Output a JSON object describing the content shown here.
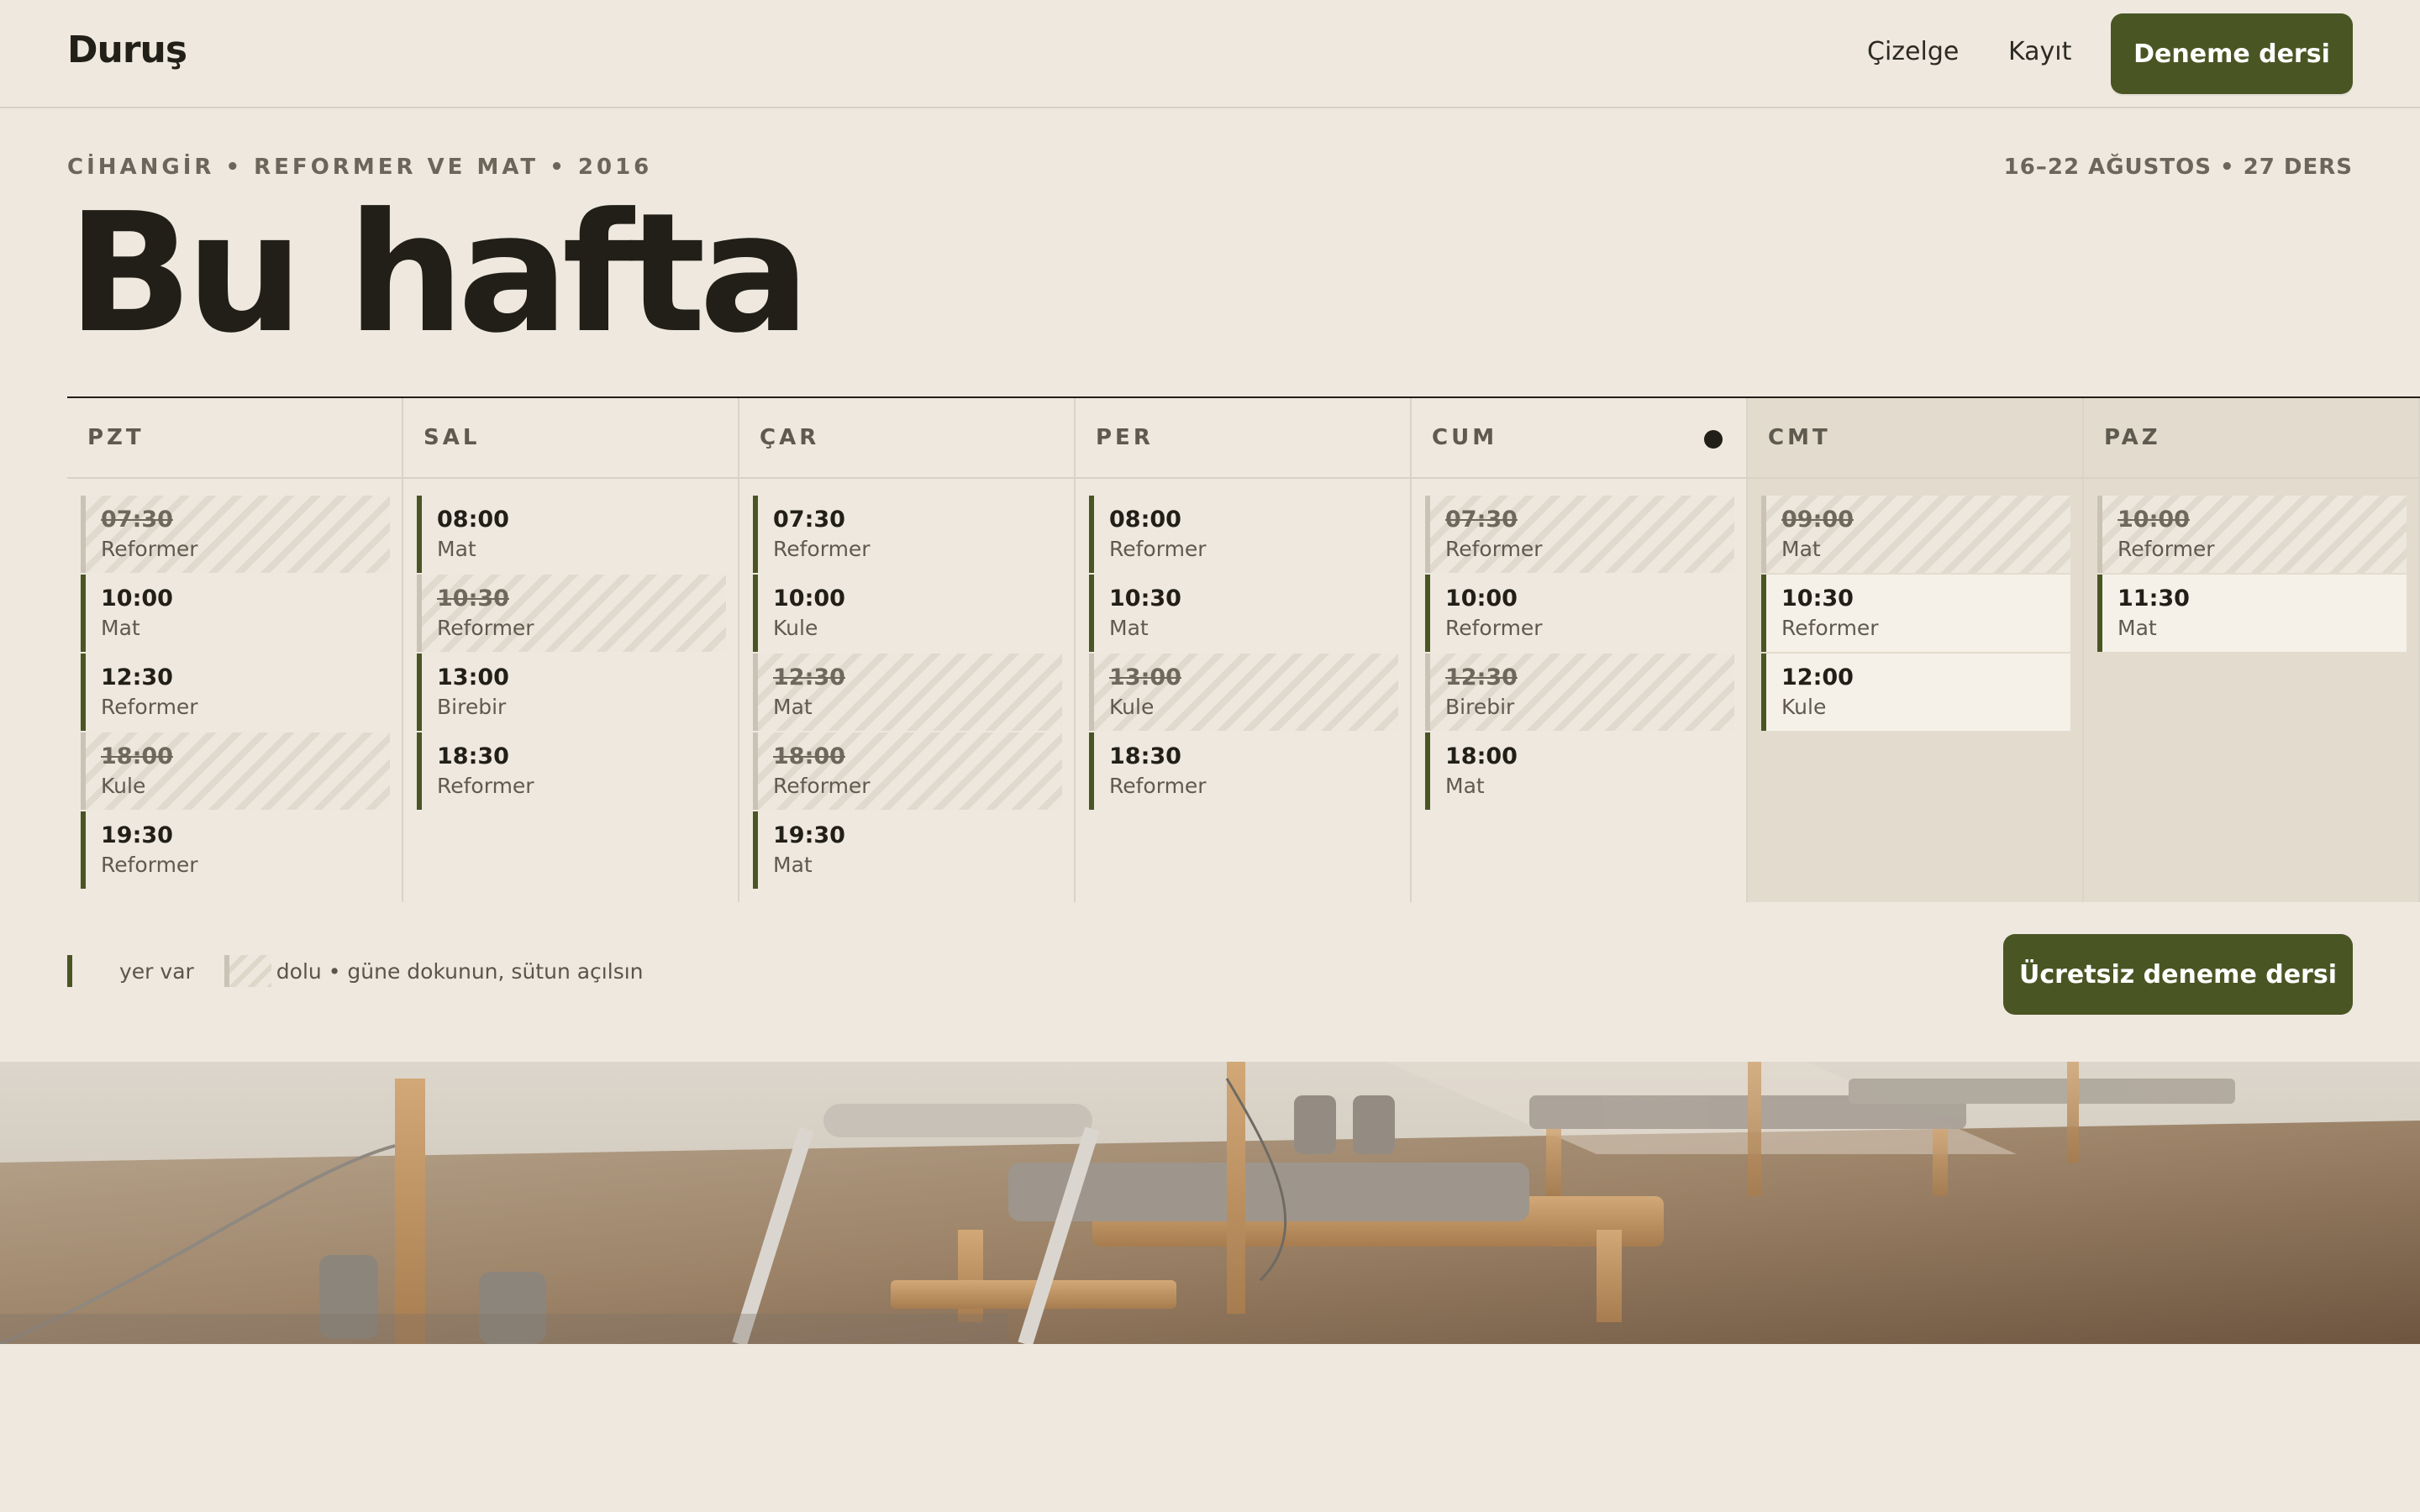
{
  "nav": {
    "logo": "Duruş",
    "links": [
      "Çizelge",
      "Kayıt"
    ],
    "cta": "Deneme dersi"
  },
  "header": {
    "eyebrow": "CİHANGİR • REFORMER VE MAT • 2016",
    "week_meta": "16–22 AĞUSTOS • 27 DERS",
    "title": "Bu hafta"
  },
  "schedule": {
    "days": [
      {
        "label": "PZT",
        "today": false,
        "weekend": false,
        "slots": [
          {
            "time": "07:30",
            "type": "Reformer",
            "full": true
          },
          {
            "time": "10:00",
            "type": "Mat",
            "full": false
          },
          {
            "time": "12:30",
            "type": "Reformer",
            "full": false
          },
          {
            "time": "18:00",
            "type": "Kule",
            "full": true
          },
          {
            "time": "19:30",
            "type": "Reformer",
            "full": false
          }
        ]
      },
      {
        "label": "SAL",
        "today": false,
        "weekend": false,
        "slots": [
          {
            "time": "08:00",
            "type": "Mat",
            "full": false
          },
          {
            "time": "10:30",
            "type": "Reformer",
            "full": true
          },
          {
            "time": "13:00",
            "type": "Birebir",
            "full": false
          },
          {
            "time": "18:30",
            "type": "Reformer",
            "full": false
          }
        ]
      },
      {
        "label": "ÇAR",
        "today": false,
        "weekend": false,
        "slots": [
          {
            "time": "07:30",
            "type": "Reformer",
            "full": false
          },
          {
            "time": "10:00",
            "type": "Kule",
            "full": false
          },
          {
            "time": "12:30",
            "type": "Mat",
            "full": true
          },
          {
            "time": "18:00",
            "type": "Reformer",
            "full": true
          },
          {
            "time": "19:30",
            "type": "Mat",
            "full": false
          }
        ]
      },
      {
        "label": "PER",
        "today": false,
        "weekend": false,
        "slots": [
          {
            "time": "08:00",
            "type": "Reformer",
            "full": false
          },
          {
            "time": "10:30",
            "type": "Mat",
            "full": false
          },
          {
            "time": "13:00",
            "type": "Kule",
            "full": true
          },
          {
            "time": "18:30",
            "type": "Reformer",
            "full": false
          }
        ]
      },
      {
        "label": "CUM",
        "today": true,
        "weekend": false,
        "slots": [
          {
            "time": "07:30",
            "type": "Reformer",
            "full": true
          },
          {
            "time": "10:00",
            "type": "Reformer",
            "full": false
          },
          {
            "time": "12:30",
            "type": "Birebir",
            "full": true
          },
          {
            "time": "18:00",
            "type": "Mat",
            "full": false
          }
        ]
      },
      {
        "label": "CMT",
        "today": false,
        "weekend": true,
        "slots": [
          {
            "time": "09:00",
            "type": "Mat",
            "full": true
          },
          {
            "time": "10:30",
            "type": "Reformer",
            "full": false
          },
          {
            "time": "12:00",
            "type": "Kule",
            "full": false
          }
        ]
      },
      {
        "label": "PAZ",
        "today": false,
        "weekend": true,
        "slots": [
          {
            "time": "10:00",
            "type": "Reformer",
            "full": true
          },
          {
            "time": "11:30",
            "type": "Mat",
            "full": false
          }
        ]
      }
    ]
  },
  "legend": {
    "open": "yer var",
    "full": "dolu • güne dokunun, sütun açılsın"
  },
  "cta": "Ücretsiz deneme dersi",
  "colors": {
    "background": "#EEE8DF",
    "accent": "#4A5524",
    "text": "#211F17",
    "weekend": "#E3DCCE"
  }
}
